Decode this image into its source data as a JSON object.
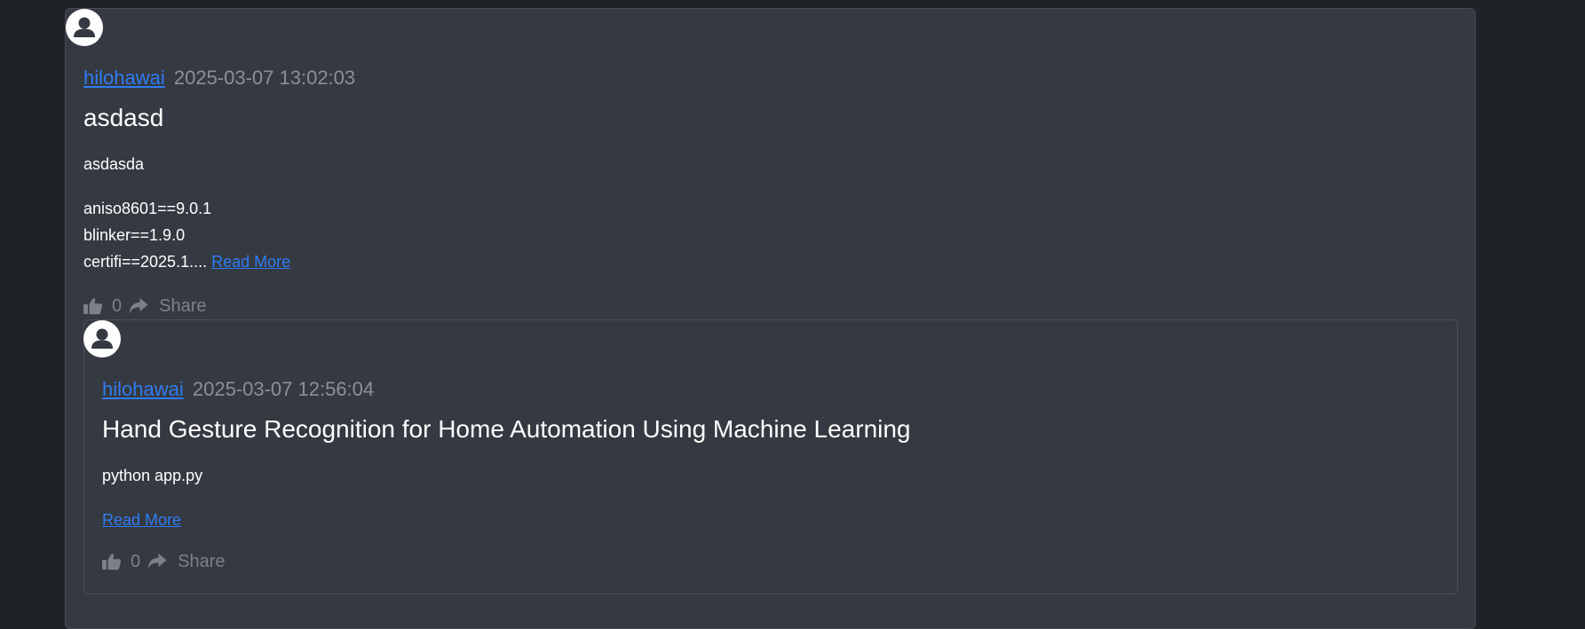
{
  "posts": [
    {
      "username": "hilohawai",
      "timestamp": "2025-03-07 13:02:03",
      "title": "asdasd",
      "body_lines": [
        "asdasda",
        "aniso8601==9.0.1",
        "blinker==1.9.0",
        "certifi==2025.1...."
      ],
      "read_more": "Read More",
      "likes": "0",
      "share_label": "Share"
    },
    {
      "username": "hilohawai",
      "timestamp": "2025-03-07 12:56:04",
      "title": "Hand Gesture Recognition for Home Automation Using Machine Learning",
      "body_lines": [
        "python app.py"
      ],
      "read_more": "Read More",
      "likes": "0",
      "share_label": "Share"
    }
  ],
  "icons": {
    "avatar": "user-avatar-icon",
    "like": "thumbs-up-icon",
    "share": "share-arrow-icon"
  },
  "colors": {
    "page_background": "#1f2227",
    "card_background": "#353941",
    "link": "#2f7cf0",
    "muted": "#8c9096",
    "text": "#ffffff"
  }
}
